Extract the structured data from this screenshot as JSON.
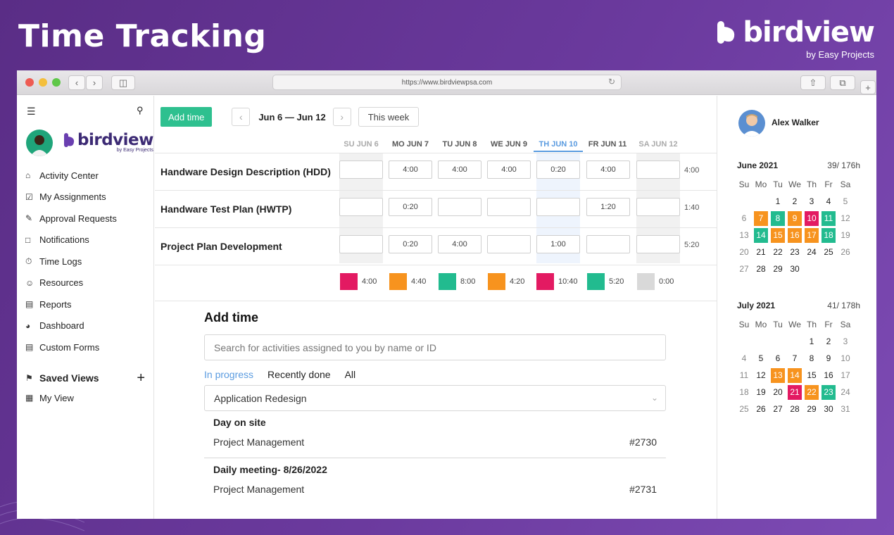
{
  "page_title": "Time Tracking",
  "brand": {
    "name": "birdview",
    "tagline": "by Easy Projects"
  },
  "browser": {
    "url": "https://www.birdviewpsa.com"
  },
  "sidebar": {
    "logo_word": "birdview",
    "logo_sub": "by Easy Projects",
    "items": [
      {
        "label": "Activity Center",
        "icon": "home-icon"
      },
      {
        "label": "My Assignments",
        "icon": "checkbox-icon"
      },
      {
        "label": "Approval Requests",
        "icon": "approval-icon"
      },
      {
        "label": "Notifications",
        "icon": "chat-icon"
      },
      {
        "label": "Time Logs",
        "icon": "timer-icon"
      },
      {
        "label": "Resources",
        "icon": "user-icon"
      },
      {
        "label": "Reports",
        "icon": "bar-chart-icon"
      },
      {
        "label": "Dashboard",
        "icon": "gauge-icon"
      },
      {
        "label": "Custom Forms",
        "icon": "form-icon"
      }
    ],
    "saved_views_label": "Saved Views",
    "my_view_label": "My View"
  },
  "toolbar": {
    "add_time_label": "Add time",
    "date_range": "Jun 6 — Jun 12",
    "this_week_label": "This week"
  },
  "timesheet": {
    "days": [
      "SU JUN 6",
      "MO JUN 7",
      "TU JUN 8",
      "WE JUN 9",
      "TH JUN 10",
      "FR JUN 11",
      "SA JUN 12"
    ],
    "rows": [
      {
        "name": "Handware Design Description (HDD)",
        "cells": [
          "",
          "4:00",
          "4:00",
          "4:00",
          "0:20",
          "4:00",
          ""
        ],
        "total": "4:00"
      },
      {
        "name": "Handware Test Plan (HWTP)",
        "cells": [
          "",
          "0:20",
          "",
          "",
          "",
          "1:20",
          ""
        ],
        "total": "1:40"
      },
      {
        "name": "Project Plan Development",
        "cells": [
          "",
          "0:20",
          "4:00",
          "",
          "1:00",
          "",
          ""
        ],
        "total": "5:20"
      }
    ],
    "day_totals": [
      {
        "value": "4:00",
        "color": "#e31a62"
      },
      {
        "value": "4:40",
        "color": "#f7931e"
      },
      {
        "value": "8:00",
        "color": "#22bb8f"
      },
      {
        "value": "4:20",
        "color": "#f7931e"
      },
      {
        "value": "10:40",
        "color": "#e31a62"
      },
      {
        "value": "5:20",
        "color": "#22bb8f"
      },
      {
        "value": "0:00",
        "color": "#d9d9d9"
      }
    ]
  },
  "add_time": {
    "title": "Add time",
    "search_placeholder": "Search for activities assigned to you by name or ID",
    "tabs": [
      "In progress",
      "Recently done",
      "All"
    ],
    "project_select": "Application Redesign",
    "activities": [
      {
        "title": "Day on site",
        "category": "Project Management",
        "id": "#2730"
      },
      {
        "title": "Daily meeting- 8/26/2022",
        "category": "Project Management",
        "id": "#2731"
      }
    ]
  },
  "user": {
    "name": "Alex Walker"
  },
  "calendars": [
    {
      "month": "June 2021",
      "hours": "39/ 176h",
      "weekdays": [
        "Su",
        "Mo",
        "Tu",
        "We",
        "Th",
        "Fr",
        "Sa"
      ],
      "first_weekday": 2,
      "days_in_month": 30,
      "highlights": {
        "7": "#f7931e",
        "8": "#22bb8f",
        "9": "#f7931e",
        "10": "#e31a62",
        "11": "#22bb8f",
        "14": "#22bb8f",
        "15": "#f7931e",
        "16": "#f7931e",
        "17": "#f7931e",
        "18": "#22bb8f"
      }
    },
    {
      "month": "July 2021",
      "hours": "41/ 178h",
      "weekdays": [
        "Su",
        "Mo",
        "Tu",
        "We",
        "Th",
        "Fr",
        "Sa"
      ],
      "first_weekday": 4,
      "days_in_month": 31,
      "highlights": {
        "13": "#f7931e",
        "14": "#f7931e",
        "21": "#e31a62",
        "22": "#f7931e",
        "23": "#22bb8f"
      }
    }
  ],
  "colors": {
    "background": "#6b3a9e",
    "accent_green": "#2ec08f",
    "today_highlight": "#5a9be0"
  }
}
